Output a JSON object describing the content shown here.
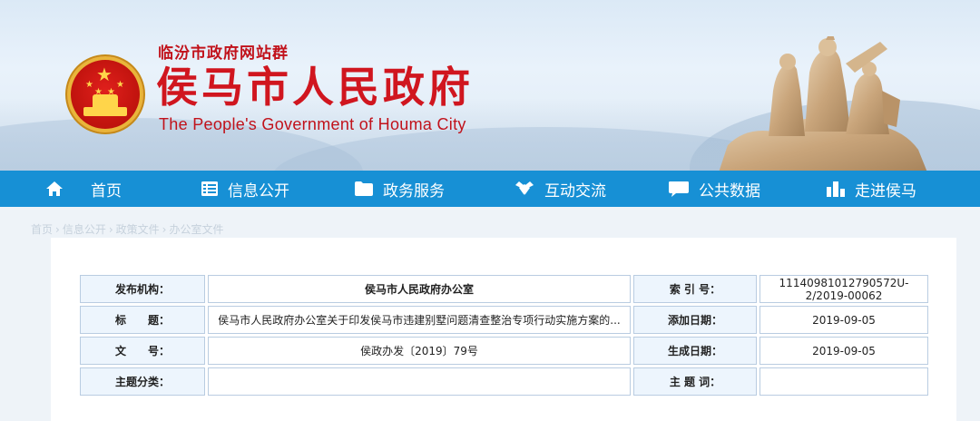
{
  "header": {
    "site_group": "临汾市政府网站群",
    "title": "侯马市人民政府",
    "subtitle": "The People's Government of Houma City"
  },
  "nav": {
    "items": [
      {
        "label": "首页",
        "icon": "home-icon"
      },
      {
        "label": "信息公开",
        "icon": "list-icon"
      },
      {
        "label": "政务服务",
        "icon": "folder-icon"
      },
      {
        "label": "互动交流",
        "icon": "handshake-icon"
      },
      {
        "label": "公共数据",
        "icon": "chat-bubble-icon"
      },
      {
        "label": "走进侯马",
        "icon": "city-icon"
      }
    ]
  },
  "breadcrumb": [
    "首页",
    "信息公开",
    "政策文件",
    "办公室文件"
  ],
  "info": {
    "publisher_label": "发布机构：",
    "publisher": "侯马市人民政府办公室",
    "index_label": "索 引 号：",
    "index_no": "11140981012790572U-2/2019-00062",
    "title_label": "标　　题：",
    "title": "侯马市人民政府办公室关于印发侯马市违建别墅问题清查整治专项行动实施方案的...",
    "added_label": "添加日期：",
    "added_date": "2019-09-05",
    "docno_label": "文　　号：",
    "doc_no": "侯政办发〔2019〕79号",
    "generated_label": "生成日期：",
    "generated_date": "2019-09-05",
    "category_label": "主题分类：",
    "category": "",
    "keywords_label": "主 题 词：",
    "keywords": ""
  },
  "colors": {
    "nav_blue": "#1790d5",
    "title_red": "#d0161f",
    "label_blue": "#1f4c8f"
  }
}
